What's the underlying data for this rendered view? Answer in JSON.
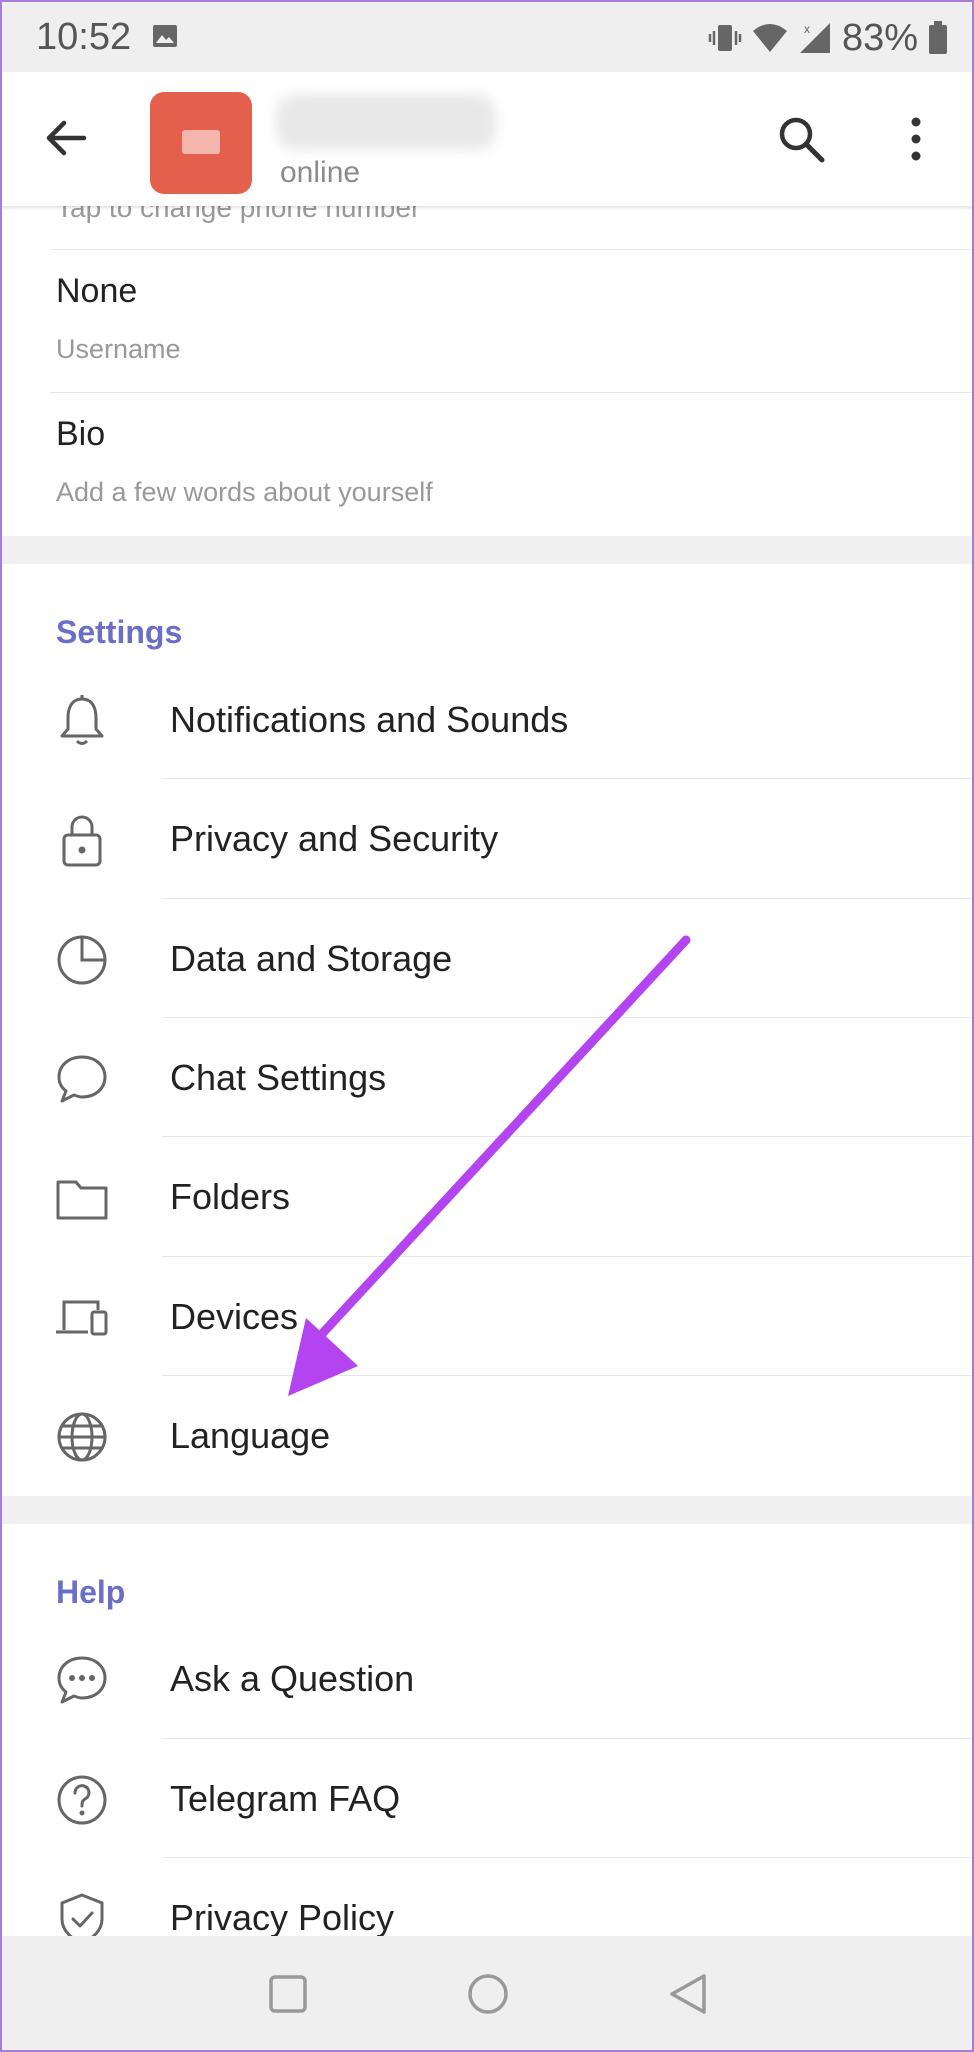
{
  "status_bar": {
    "time": "10:52",
    "battery": "83%"
  },
  "header": {
    "status": "online"
  },
  "profile": {
    "cutoff_text": "Tap to change phone number",
    "username_value": "None",
    "username_label": "Username",
    "bio_value": "Bio",
    "bio_placeholder": "Add a few words about yourself"
  },
  "settings": {
    "title": "Settings",
    "items": [
      {
        "label": "Notifications and Sounds",
        "icon": "bell-icon"
      },
      {
        "label": "Privacy and Security",
        "icon": "lock-icon"
      },
      {
        "label": "Data and Storage",
        "icon": "pie-chart-icon"
      },
      {
        "label": "Chat Settings",
        "icon": "chat-bubble-icon"
      },
      {
        "label": "Folders",
        "icon": "folder-icon"
      },
      {
        "label": "Devices",
        "icon": "devices-icon"
      },
      {
        "label": "Language",
        "icon": "globe-icon"
      }
    ]
  },
  "help": {
    "title": "Help",
    "items": [
      {
        "label": "Ask a Question",
        "icon": "question-chat-icon"
      },
      {
        "label": "Telegram FAQ",
        "icon": "question-circle-icon"
      },
      {
        "label": "Privacy Policy",
        "icon": "shield-check-icon"
      }
    ]
  },
  "colors": {
    "accent": "#6b6fc7",
    "annotation_arrow": "#b344f0",
    "avatar": "#e4604c"
  }
}
